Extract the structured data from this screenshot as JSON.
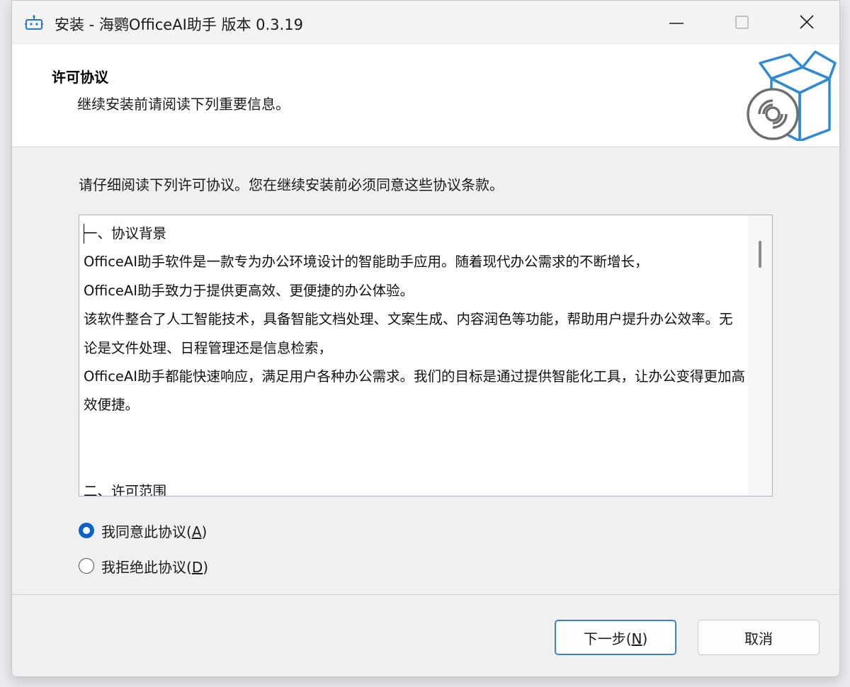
{
  "window": {
    "title": "安装 - 海鹦OfficeAI助手 版本 0.3.19",
    "accent_color": "#0a64c8",
    "app_icon": "installer-robot-icon"
  },
  "header": {
    "title": "许可协议",
    "subtitle": "继续安装前请阅读下列重要信息。",
    "logo_icon": "open-box-with-disc-icon"
  },
  "main": {
    "instruction": "请仔细阅读下列许可协议。您在继续安装前必须同意这些协议条款。",
    "license_text": [
      "一、协议背景",
      "OfficeAI助手软件是一款专为办公环境设计的智能助手应用。随着现代办公需求的不断增长，",
      "OfficeAI助手致力于提供更高效、更便捷的办公体验。",
      "该软件整合了人工智能技术，具备智能文档处理、文案生成、内容润色等功能，帮助用户提升办公效率。无论是文件处理、日程管理还是信息检索，",
      "OfficeAI助手都能快速响应，满足用户各种办公需求。我们的目标是通过提供智能化工具，让办公变得更加高效便捷。",
      "二、许可范围"
    ],
    "radio_accept": {
      "label": "我同意此协议(",
      "accel": "A",
      "suffix": ")",
      "checked": true
    },
    "radio_decline": {
      "label": "我拒绝此协议(",
      "accel": "D",
      "suffix": ")",
      "checked": false
    }
  },
  "footer": {
    "next": {
      "label": "下一步(",
      "accel": "N",
      "suffix": ")"
    },
    "cancel": {
      "label": "取消"
    }
  }
}
